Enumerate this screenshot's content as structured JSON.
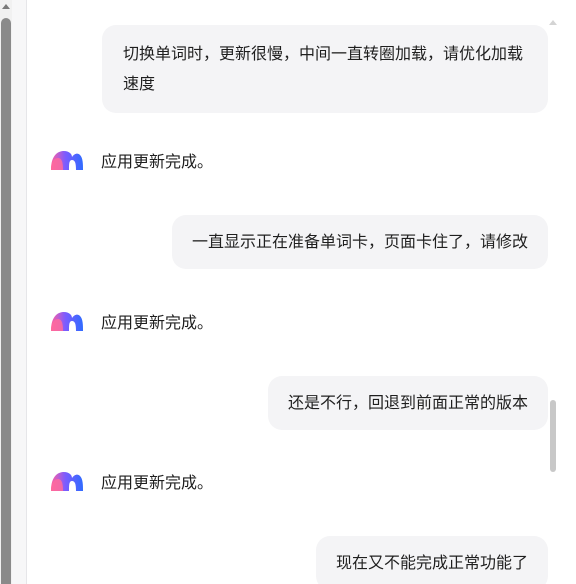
{
  "messages": [
    {
      "role": "user",
      "text": "切换单词时，更新很慢，中间一直转圈加载，请优化加载速度"
    },
    {
      "role": "assistant",
      "text": "应用更新完成。"
    },
    {
      "role": "user",
      "text": "一直显示正在准备单词卡，页面卡住了，请修改"
    },
    {
      "role": "assistant",
      "text": "应用更新完成。"
    },
    {
      "role": "user",
      "text": "还是不行，回退到前面正常的版本"
    },
    {
      "role": "assistant",
      "text": "应用更新完成。"
    },
    {
      "role": "user",
      "text": "现在又不能完成正常功能了"
    }
  ],
  "assistant": {
    "avatar_icon": "assistant-logo-icon",
    "avatar_colors": [
      "#ff5fa2",
      "#7b5cff",
      "#2f6bff"
    ]
  },
  "colors": {
    "user_bubble_bg": "#f4f4f6",
    "text": "#1f1f1f"
  }
}
